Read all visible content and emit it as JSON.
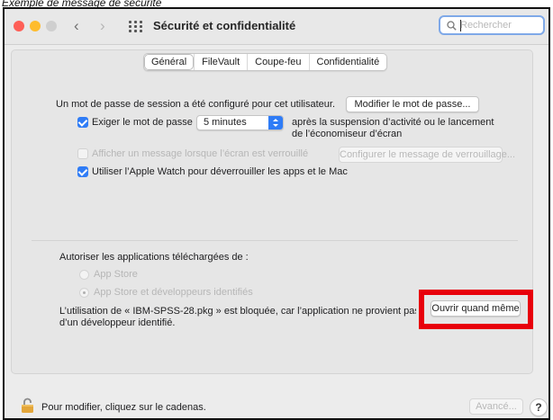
{
  "caption": "Exemple de message de sécurité",
  "window": {
    "title": "Sécurité et confidentialité",
    "search_placeholder": "Rechercher"
  },
  "tabs": [
    {
      "label": "Général",
      "active": true
    },
    {
      "label": "FileVault",
      "active": false
    },
    {
      "label": "Coupe-feu",
      "active": false
    },
    {
      "label": "Confidentialité",
      "active": false
    }
  ],
  "general": {
    "password_text": "Un mot de passe de session a été configuré pour cet utilisateur.",
    "change_password_button": "Modifier le mot de passe...",
    "require_password_label": "Exiger le mot de passe",
    "require_password_checked": true,
    "require_password_delay": "5 minutes",
    "require_password_suffix_line1": "après la suspension d’activité ou le lancement",
    "require_password_suffix_line2": "de l’économiseur d’écran",
    "lock_message_label": "Afficher un message lorsque l’écran est verrouillé",
    "lock_message_checked": false,
    "lock_message_button": "Configurer le message de verrouillage...",
    "apple_watch_label": "Utiliser l’Apple Watch pour déverrouiller les apps et le Mac",
    "apple_watch_checked": true
  },
  "downloads": {
    "heading": "Autoriser les applications téléchargées de :",
    "options": [
      {
        "label": "App Store",
        "selected": false
      },
      {
        "label": "App Store et développeurs identifiés",
        "selected": true
      }
    ],
    "blocked_line1": "L’utilisation de « IBM-SPSS-28.pkg » est bloquée, car l’application ne provient pas",
    "blocked_line2": "d’un développeur identifié.",
    "open_anyway_button": "Ouvrir quand même"
  },
  "footer": {
    "lock_text": "Pour modifier, cliquez sur le cadenas.",
    "advanced_button": "Avancé...",
    "help_button": "?"
  },
  "colors": {
    "accent": "#2f7cf6",
    "highlight": "#e8000b"
  }
}
